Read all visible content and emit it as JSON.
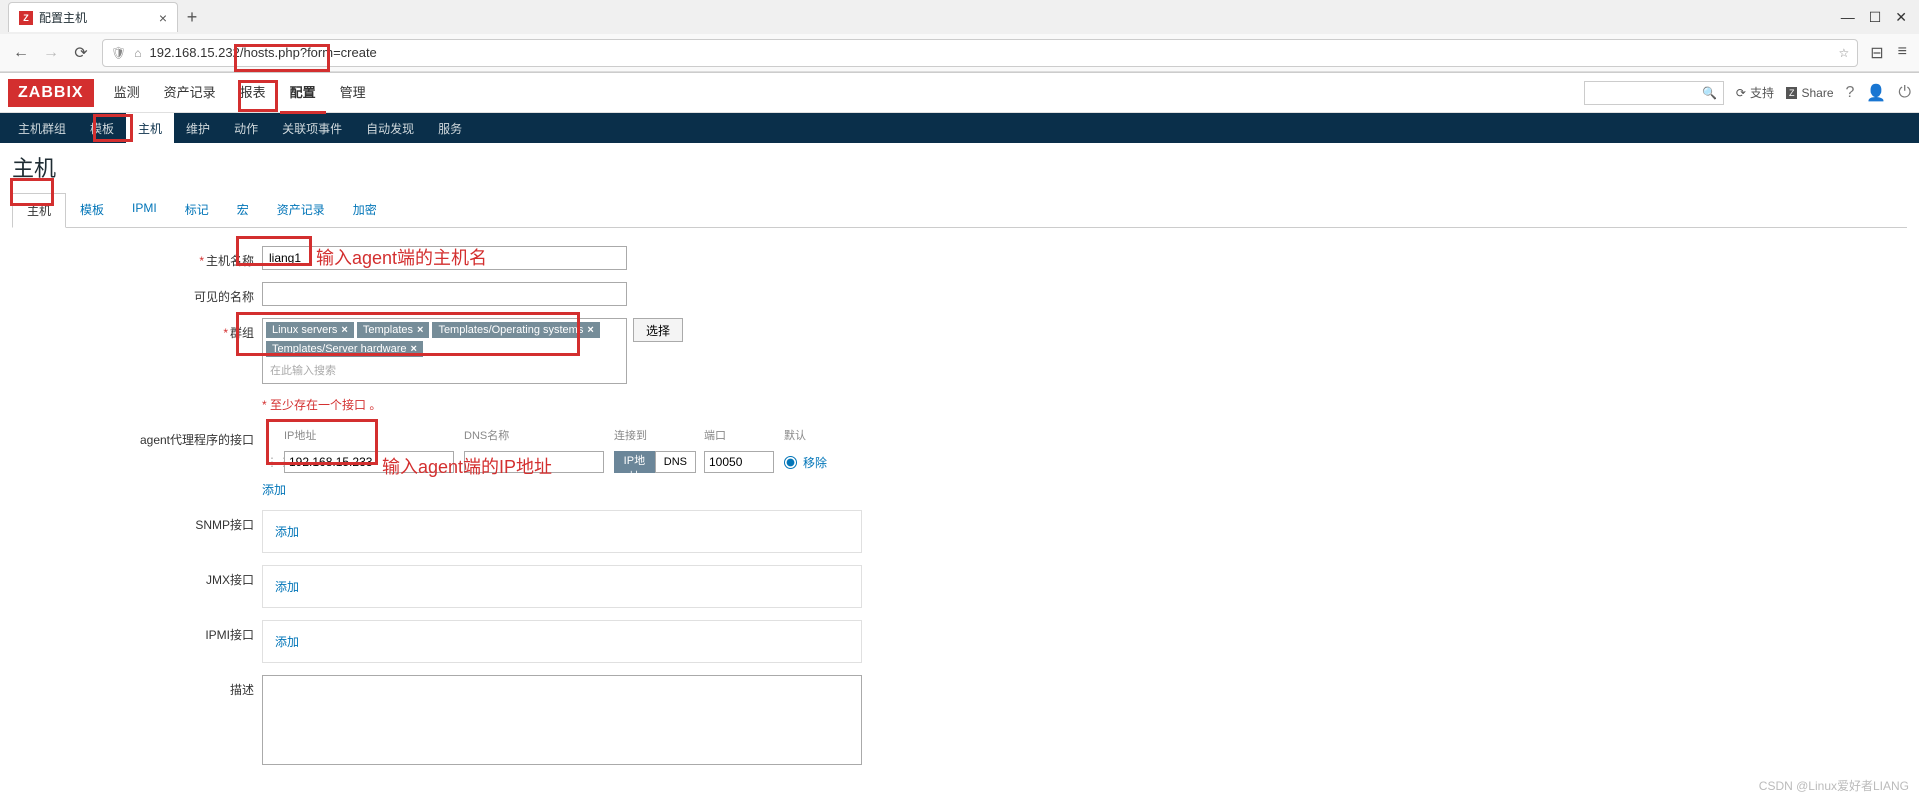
{
  "browser": {
    "tab_title": "配置主机",
    "url": "192.168.15.232/hosts.php?form=create"
  },
  "window_controls": {
    "min": "—",
    "max": "☐",
    "close": "✕"
  },
  "header": {
    "logo": "ZABBIX",
    "nav": [
      "监测",
      "资产记录",
      "报表",
      "配置",
      "管理"
    ],
    "nav_active_index": 3,
    "support": "支持",
    "share": "Share"
  },
  "subnav": {
    "items": [
      "主机群组",
      "模板",
      "主机",
      "维护",
      "动作",
      "关联项事件",
      "自动发现",
      "服务"
    ],
    "active_index": 2
  },
  "page_title": "主机",
  "form_tabs": {
    "items": [
      "主机",
      "模板",
      "IPMI",
      "标记",
      "宏",
      "资产记录",
      "加密"
    ],
    "active_index": 0
  },
  "labels": {
    "host_name": "主机名称",
    "visible_name": "可见的名称",
    "groups": "群组",
    "groups_placeholder": "在此输入搜索",
    "select_btn": "选择",
    "interface_err": "至少存在一个接口 。",
    "agent_iface": "agent代理程序的接口",
    "snmp_iface": "SNMP接口",
    "jmx_iface": "JMX接口",
    "ipmi_iface": "IPMI接口",
    "description": "描述",
    "add": "添加",
    "remove": "移除"
  },
  "iface_headers": {
    "ip": "IP地址",
    "dns": "DNS名称",
    "connect_to": "连接到",
    "port": "端口",
    "default": "默认"
  },
  "form_values": {
    "host_name": "liang1",
    "visible_name": "",
    "groups": [
      "Linux servers",
      "Templates",
      "Templates/Operating systems",
      "Templates/Server hardware"
    ],
    "agent_ip": "192.168.15.233",
    "agent_dns": "",
    "agent_port": "10050",
    "connect_ip": "IP地址",
    "connect_dns": "DNS"
  },
  "annotations": {
    "host_name_hint": "输入agent端的主机名",
    "ip_hint": "输入agent端的IP地址"
  },
  "watermark": "CSDN @Linux爱好者LIANG"
}
